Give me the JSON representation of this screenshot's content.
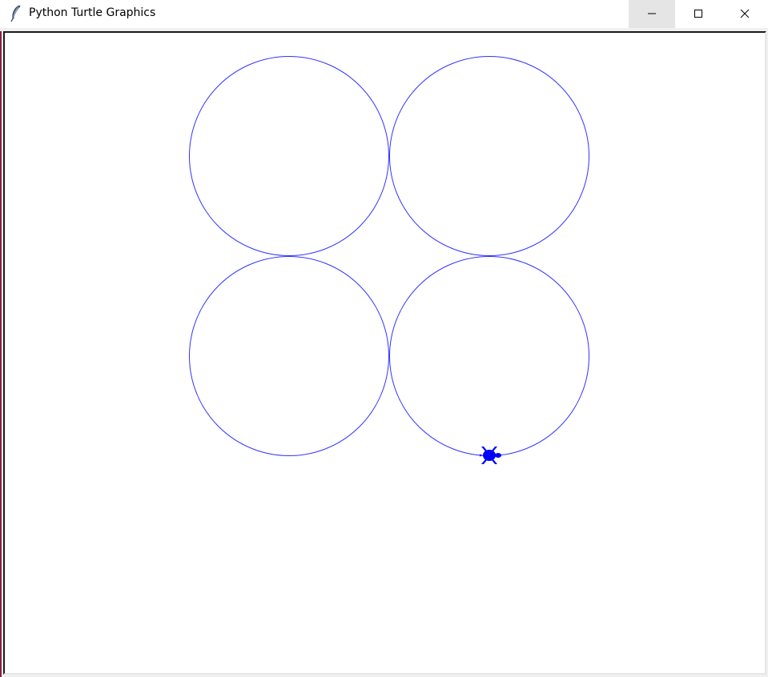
{
  "window": {
    "title": "Python Turtle Graphics",
    "app_icon": "feather-icon"
  },
  "controls": {
    "minimize_icon": "minimize-icon",
    "maximize_icon": "maximize-icon",
    "close_icon": "close-icon"
  },
  "canvas": {
    "background": "#ffffff",
    "pen_color": "#3333ff",
    "turtle_color": "#0000ff",
    "turtle_icon": "turtle-icon",
    "circle_count": 4
  }
}
